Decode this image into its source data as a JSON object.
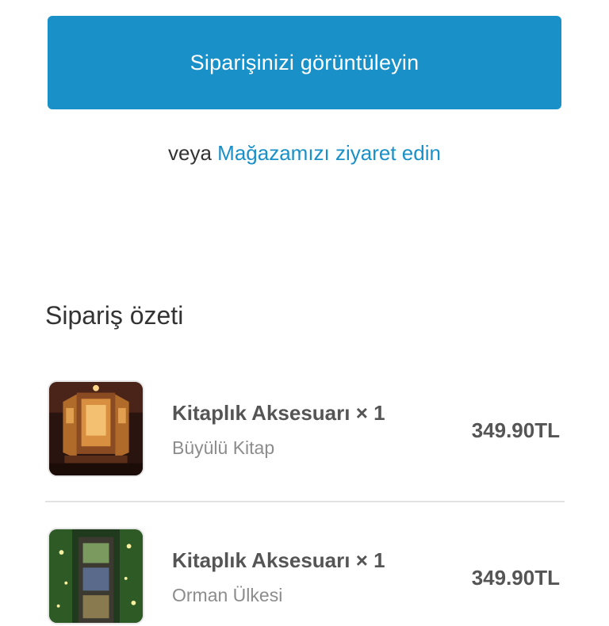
{
  "actions": {
    "view_order_label": "Siparişinizi görüntüleyin",
    "or_text": "veya",
    "visit_store_label": "Mağazamızı ziyaret edin"
  },
  "summary": {
    "title": "Sipariş özeti",
    "items": [
      {
        "name": "Kitaplık Aksesuarı × 1",
        "variant": "Büyülü Kitap",
        "price": "349.90TL",
        "thumbnail": "magic-book-diorama-image"
      },
      {
        "name": "Kitaplık Aksesuarı × 1",
        "variant": "Orman Ülkesi",
        "price": "349.90TL",
        "thumbnail": "forest-land-diorama-image"
      }
    ]
  },
  "colors": {
    "accent": "#1a90c8",
    "text": "#333333",
    "muted": "#8c8c8c"
  }
}
